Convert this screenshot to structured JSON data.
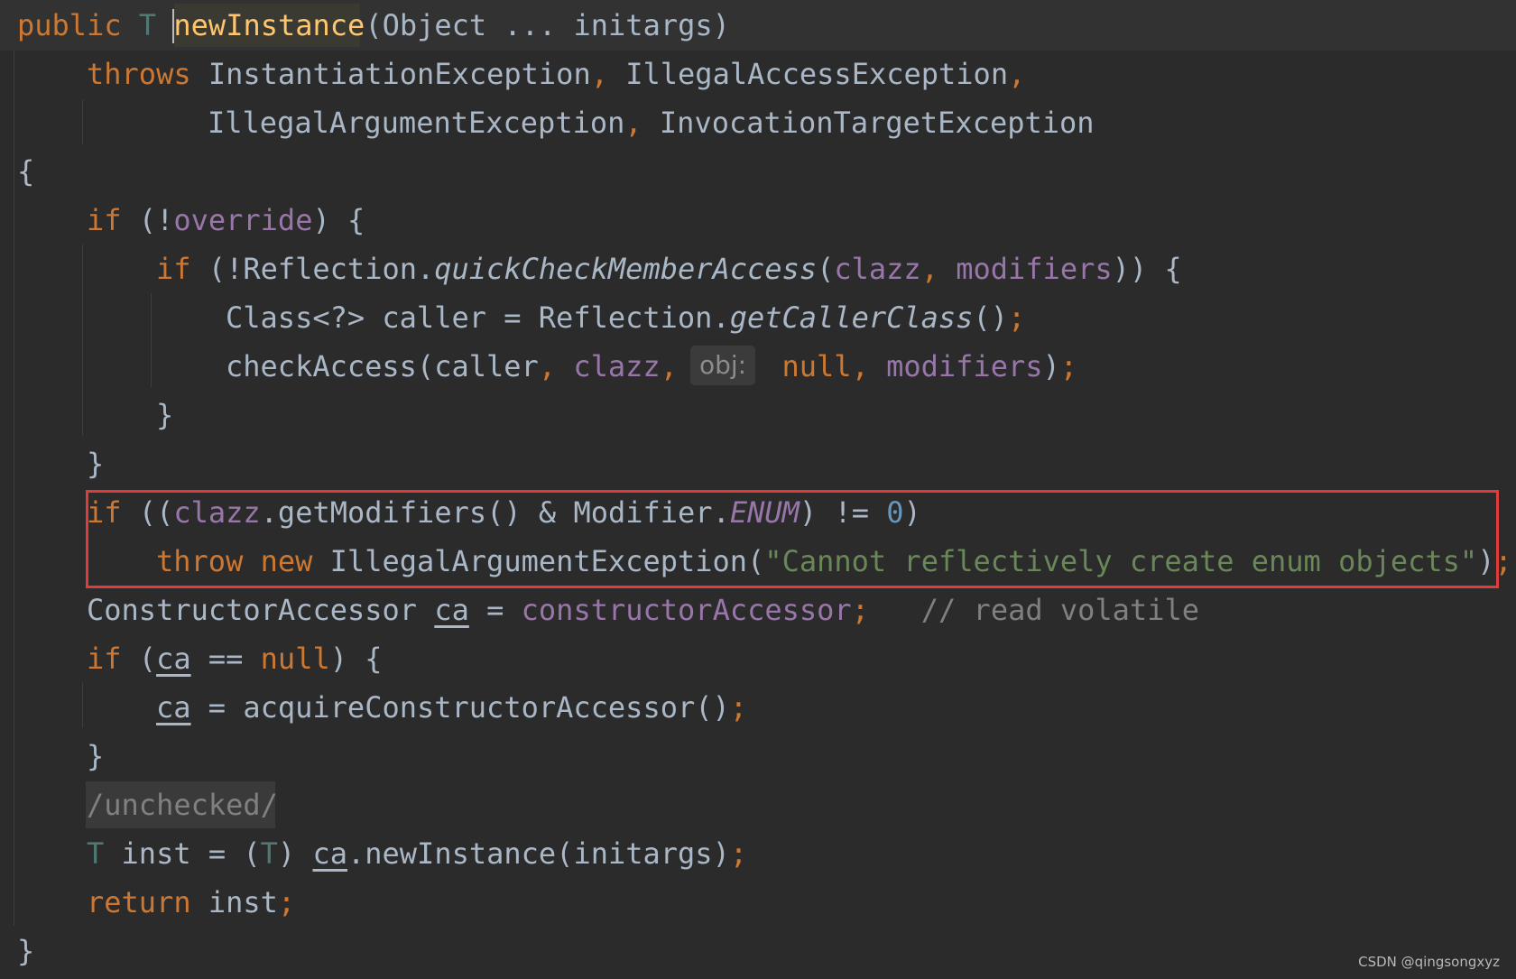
{
  "theme": {
    "background": "#2b2b2b",
    "caret_row_background": "#323232",
    "default_text": "#a9b7c6",
    "keyword": "#cc7832",
    "method_declaration": "#ffc66d",
    "field": "#9876aa",
    "string": "#6a8759",
    "number": "#6897bb",
    "comment": "#808080",
    "type_parameter": "#507874",
    "annotation": "#bbb529",
    "highlight_box": "#e03c3c"
  },
  "editor": {
    "lines": [
      {
        "indent": 1,
        "tokens": [
          {
            "t": "public ",
            "k": "kw"
          },
          {
            "t": "T ",
            "k": "tp"
          },
          {
            "t": "newInstance",
            "k": "md"
          },
          {
            "t": "(Object ... initargs)",
            "k": "df"
          }
        ]
      },
      {
        "indent": 5,
        "tokens": [
          {
            "t": "throws ",
            "k": "kw"
          },
          {
            "t": "InstantiationException",
            "k": "df"
          },
          {
            "t": ", ",
            "k": "kw"
          },
          {
            "t": "IllegalAccessException",
            "k": "df"
          },
          {
            "t": ",",
            "k": "kw"
          }
        ]
      },
      {
        "indent": 12,
        "tokens": [
          {
            "t": "IllegalArgumentException",
            "k": "df"
          },
          {
            "t": ", ",
            "k": "kw"
          },
          {
            "t": "InvocationTargetException",
            "k": "df"
          }
        ]
      },
      {
        "indent": 1,
        "tokens": [
          {
            "t": "{",
            "k": "df"
          }
        ]
      },
      {
        "indent": 5,
        "tokens": [
          {
            "t": "if ",
            "k": "kw"
          },
          {
            "t": "(!",
            "k": "df"
          },
          {
            "t": "override",
            "k": "fd"
          },
          {
            "t": ") {",
            "k": "df"
          }
        ]
      },
      {
        "indent": 9,
        "tokens": [
          {
            "t": "if ",
            "k": "kw"
          },
          {
            "t": "(!Reflection.",
            "k": "df"
          },
          {
            "t": "quickCheckMemberAccess",
            "k": "it"
          },
          {
            "t": "(",
            "k": "df"
          },
          {
            "t": "clazz",
            "k": "fd"
          },
          {
            "t": ", ",
            "k": "kw"
          },
          {
            "t": "modifiers",
            "k": "fd"
          },
          {
            "t": ")) {",
            "k": "df"
          }
        ]
      },
      {
        "indent": 13,
        "tokens": [
          {
            "t": "Class<?> caller = Reflection.",
            "k": "df"
          },
          {
            "t": "getCallerClass",
            "k": "it"
          },
          {
            "t": "()",
            "k": "df"
          },
          {
            "t": ";",
            "k": "kw"
          }
        ]
      },
      {
        "indent": 13,
        "hint": true,
        "tokens": [
          {
            "t": "checkAccess(caller",
            "k": "df"
          },
          {
            "t": ", ",
            "k": "kw"
          },
          {
            "t": "clazz",
            "k": "fd"
          },
          {
            "t": ",      ",
            "k": "kw"
          },
          {
            "t": "null",
            "k": "kw"
          },
          {
            "t": ", ",
            "k": "kw"
          },
          {
            "t": "modifiers",
            "k": "fd"
          },
          {
            "t": ")",
            "k": "df"
          },
          {
            "t": ";",
            "k": "kw"
          }
        ]
      },
      {
        "indent": 9,
        "tokens": [
          {
            "t": "}",
            "k": "df"
          }
        ]
      },
      {
        "indent": 5,
        "tokens": [
          {
            "t": "}",
            "k": "df"
          }
        ]
      },
      {
        "indent": 5,
        "tokens": [
          {
            "t": "if ",
            "k": "kw"
          },
          {
            "t": "((",
            "k": "df"
          },
          {
            "t": "clazz",
            "k": "fd"
          },
          {
            "t": ".getModifiers() & Modifier.",
            "k": "df"
          },
          {
            "t": "ENUM",
            "k": "itf"
          },
          {
            "t": ") != ",
            "k": "df"
          },
          {
            "t": "0",
            "k": "nm"
          },
          {
            "t": ")",
            "k": "df"
          }
        ]
      },
      {
        "indent": 9,
        "tokens": [
          {
            "t": "throw new ",
            "k": "kw"
          },
          {
            "t": "IllegalArgumentException(",
            "k": "df"
          },
          {
            "t": "\"Cannot reflectively create enum objects\"",
            "k": "st"
          },
          {
            "t": ")",
            "k": "df"
          },
          {
            "t": ";",
            "k": "kw"
          }
        ]
      },
      {
        "indent": 5,
        "tokens": [
          {
            "t": "ConstructorAccessor ",
            "k": "df"
          },
          {
            "t": "ca",
            "k": "ul"
          },
          {
            "t": " = ",
            "k": "df"
          },
          {
            "t": "constructorAccessor",
            "k": "fd"
          },
          {
            "t": ";   ",
            "k": "kw"
          },
          {
            "t": "// read volatile",
            "k": "cm"
          }
        ]
      },
      {
        "indent": 5,
        "tokens": [
          {
            "t": "if ",
            "k": "kw"
          },
          {
            "t": "(",
            "k": "df"
          },
          {
            "t": "ca",
            "k": "ul"
          },
          {
            "t": " == ",
            "k": "df"
          },
          {
            "t": "null",
            "k": "kw"
          },
          {
            "t": ") {",
            "k": "df"
          }
        ]
      },
      {
        "indent": 9,
        "tokens": [
          {
            "t": "ca",
            "k": "ul"
          },
          {
            "t": " = acquireConstructorAccessor()",
            "k": "df"
          },
          {
            "t": ";",
            "k": "kw"
          }
        ]
      },
      {
        "indent": 5,
        "tokens": [
          {
            "t": "}",
            "k": "df"
          }
        ]
      },
      {
        "indent": 5,
        "annotation": true,
        "tokens": [
          {
            "t": "/unchecked/",
            "k": "cm"
          }
        ]
      },
      {
        "indent": 5,
        "tokens": [
          {
            "t": "T ",
            "k": "tp"
          },
          {
            "t": "inst = (",
            "k": "df"
          },
          {
            "t": "T",
            "k": "tp"
          },
          {
            "t": ") ",
            "k": "df"
          },
          {
            "t": "ca",
            "k": "ul"
          },
          {
            "t": ".newInstance(initargs)",
            "k": "df"
          },
          {
            "t": ";",
            "k": "kw"
          }
        ]
      },
      {
        "indent": 5,
        "tokens": [
          {
            "t": "return ",
            "k": "kw"
          },
          {
            "t": "inst",
            "k": "df"
          },
          {
            "t": ";",
            "k": "kw"
          }
        ]
      },
      {
        "indent": 1,
        "tokens": [
          {
            "t": "}",
            "k": "df"
          }
        ]
      }
    ]
  },
  "inlay_hint": {
    "label": "obj:"
  },
  "watermark": "CSDN @qingsongxyz"
}
